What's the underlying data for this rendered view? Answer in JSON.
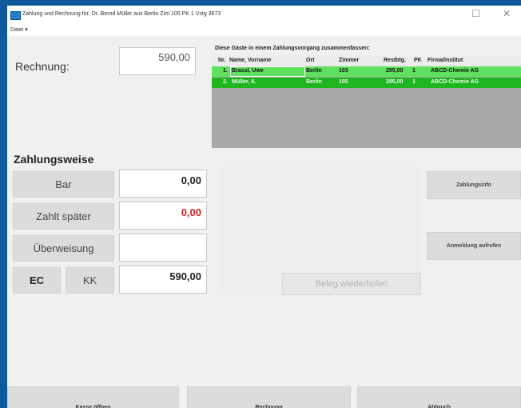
{
  "window": {
    "title": "Zahlung und Rechnung für: Dr. Bernd Müller aus Berlin Zim 105 PK 1 Vstg 3673",
    "minimize": "☐",
    "close": "✕"
  },
  "menu": {
    "datei": "Datei ▾"
  },
  "rechnung": {
    "label": "Rechnung:",
    "amount": "590,00"
  },
  "guests": {
    "title": "Diese Gäste in einem Zahlungsvorgang zusammenfassen:",
    "columns": [
      "Nr.",
      "Name, Vorname",
      "Ort",
      "Zimmer",
      "Restbtg.",
      "PK",
      "Firma/Institut"
    ],
    "rows": [
      {
        "nr": "1.",
        "name": "Brassl, Uwe",
        "ort": "Berlin",
        "zimmer": "103",
        "rest": "295,00",
        "pk": "1",
        "firma": "ABCD-Chemie AG"
      },
      {
        "nr": "2.",
        "name": "Müller, A.",
        "ort": "Berlin",
        "zimmer": "105",
        "rest": "295,00",
        "pk": "1",
        "firma": "ABCD-Chemie AG"
      }
    ]
  },
  "zahlungsweise": {
    "title": "Zahlungsweise",
    "bar": {
      "label": "Bar",
      "value": "0,00"
    },
    "spaeter": {
      "label": "Zahlt später",
      "value": "0,00"
    },
    "ueberweisung": {
      "label": "Überweisung",
      "value": ""
    },
    "ec": {
      "label": "EC"
    },
    "kk": {
      "label": "KK",
      "value": "590,00"
    }
  },
  "buttons": {
    "zahlungsinfo": "Zahlungsinfo",
    "anmeldung": "Anmeldung aufrufen",
    "beleg": "Beleg wiederholen",
    "kasse": "Kasse öffnen",
    "rechnung": "Rechnung",
    "abbruch": "Abbruch"
  },
  "colors": {
    "titlebar_accent": "#0e5a9c",
    "row_selected": "#5fe05f",
    "row_other": "#1fb51f",
    "negative_value": "#d42020"
  }
}
